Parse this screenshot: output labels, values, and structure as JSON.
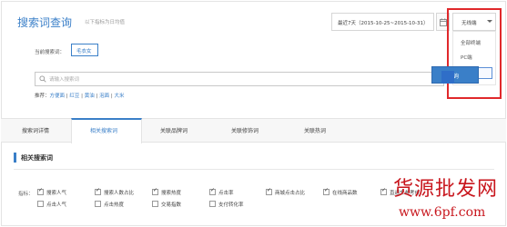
{
  "header": {
    "title": "搜索词查询",
    "subtitle": "以下指标为日均值",
    "date_range": "最近7天（2015-10-25~2015-10-31）",
    "device_select": "无线端",
    "device_options": [
      "全部终端",
      "PC端",
      "无线端"
    ]
  },
  "search": {
    "current_label": "当前搜索词：",
    "current_term": "毛衣女",
    "placeholder": "请输入搜索词",
    "button_label": "查询",
    "recommend_label": "推荐：",
    "recommend_items": [
      "方便面",
      "红豆",
      "黄油",
      "泡面",
      "大米"
    ]
  },
  "tabs": [
    "搜索词详情",
    "相关搜索词",
    "关联品牌词",
    "关联修饰词",
    "关联热词"
  ],
  "active_tab": 1,
  "section": {
    "title": "相关搜索词"
  },
  "metrics": {
    "label": "指标：",
    "row1": [
      {
        "label": "搜索人气",
        "checked": true
      },
      {
        "label": "搜索人数占比",
        "checked": true
      },
      {
        "label": "搜索热度",
        "checked": true
      },
      {
        "label": "点击率",
        "checked": true
      },
      {
        "label": "商城点击占比",
        "checked": true
      },
      {
        "label": "在线商品数",
        "checked": true
      },
      {
        "label": "直通车参考价",
        "checked": true
      }
    ],
    "row2": [
      {
        "label": "点击人气",
        "checked": false
      },
      {
        "label": "点击热度",
        "checked": false
      },
      {
        "label": "交易指数",
        "checked": false
      },
      {
        "label": "支付转化率",
        "checked": false
      }
    ]
  },
  "watermark": {
    "line1": "货源批发网",
    "line2": "www.6pf.com"
  },
  "colors": {
    "accent": "#3a7fc8",
    "highlight_box": "#e0282b",
    "watermark": "#c8161d"
  }
}
